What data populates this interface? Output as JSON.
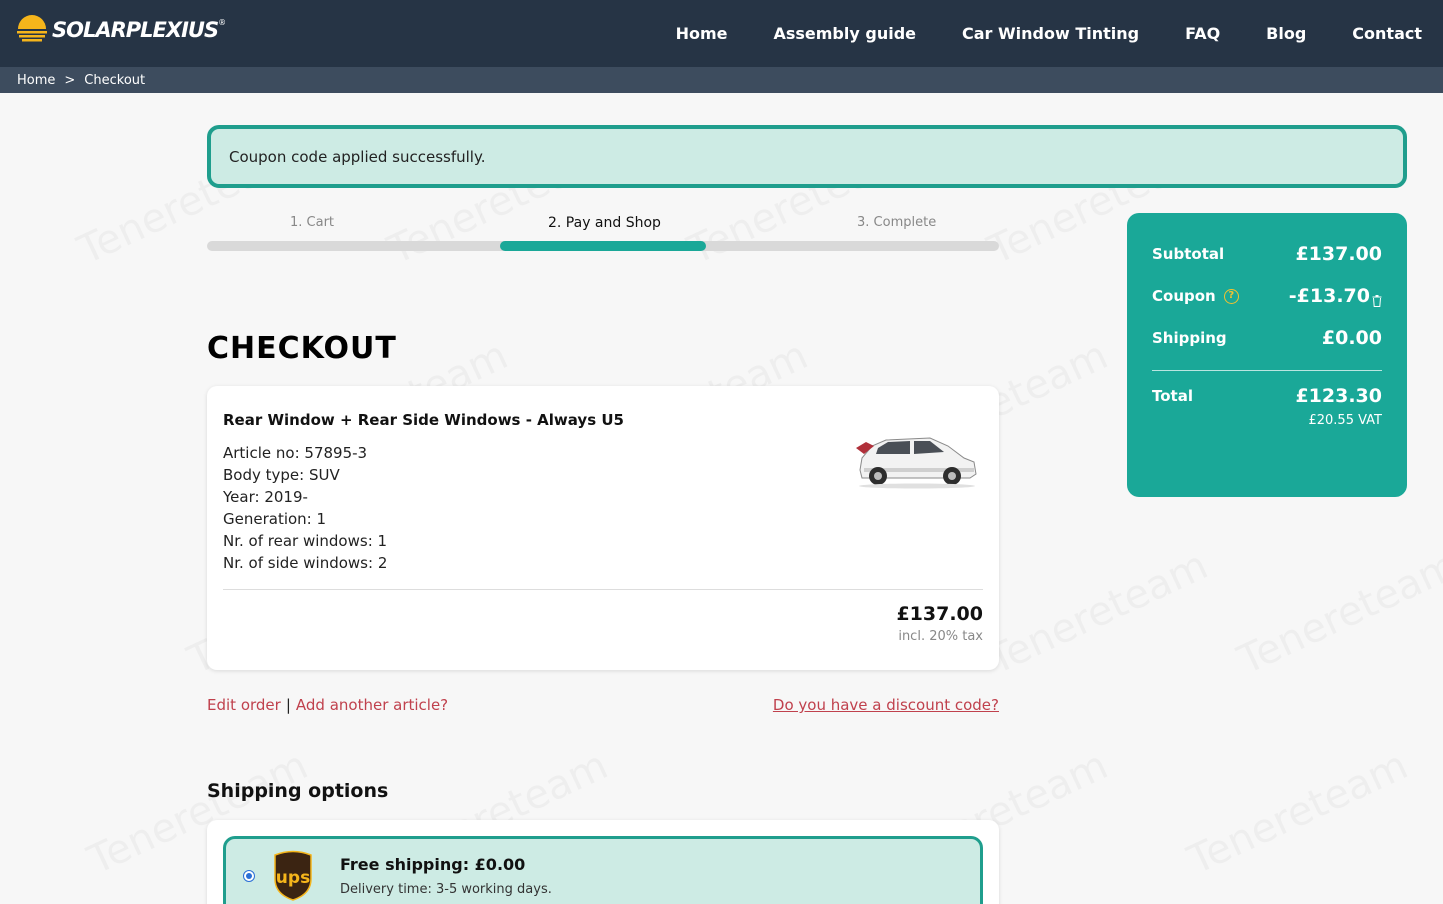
{
  "header": {
    "brand": "SOLARPLEXIUS",
    "brand_mark": "®",
    "nav": [
      "Home",
      "Assembly guide",
      "Car Window Tinting",
      "FAQ",
      "Blog",
      "Contact"
    ]
  },
  "breadcrumb": {
    "home": "Home",
    "separator": ">",
    "current": "Checkout"
  },
  "alert": {
    "message": "Coupon code applied successfully."
  },
  "steps": {
    "items": [
      "1. Cart",
      "2. Pay and Shop",
      "3. Complete"
    ],
    "active_index": 1
  },
  "page_title": "CHECKOUT",
  "item": {
    "title": "Rear Window + Rear Side Windows - Always U5",
    "specs": [
      "Article no: 57895-3",
      "Body type: SUV",
      "Year: 2019-",
      "Generation: 1",
      "Nr. of rear windows: 1",
      "Nr. of side windows: 2"
    ],
    "price": "£137.00",
    "tax_note": "incl. 20% tax"
  },
  "links": {
    "edit_order": "Edit order",
    "pipe": "|",
    "add_article": "Add another article?",
    "discount": "Do you have a discount code?"
  },
  "shipping": {
    "title": "Shipping options",
    "option_name": "Free shipping: £0.00",
    "option_sub": "Delivery time: 3-5 working days.",
    "carrier_logo": "ups"
  },
  "summary": {
    "subtotal_label": "Subtotal",
    "subtotal_value": "£137.00",
    "coupon_label": "Coupon",
    "coupon_value": "-£13.70",
    "shipping_label": "Shipping",
    "shipping_value": "£0.00",
    "total_label": "Total",
    "total_value": "£123.30",
    "vat_value": "£20.55 VAT"
  },
  "colors": {
    "header_bg": "#263445",
    "accent": "#1aa898",
    "link": "#c0414d",
    "alert_bg": "#cdebe4"
  },
  "icons": [
    "sun-logo-icon",
    "help-icon",
    "trash-icon",
    "car-image",
    "ups-logo",
    "radio-selected"
  ]
}
